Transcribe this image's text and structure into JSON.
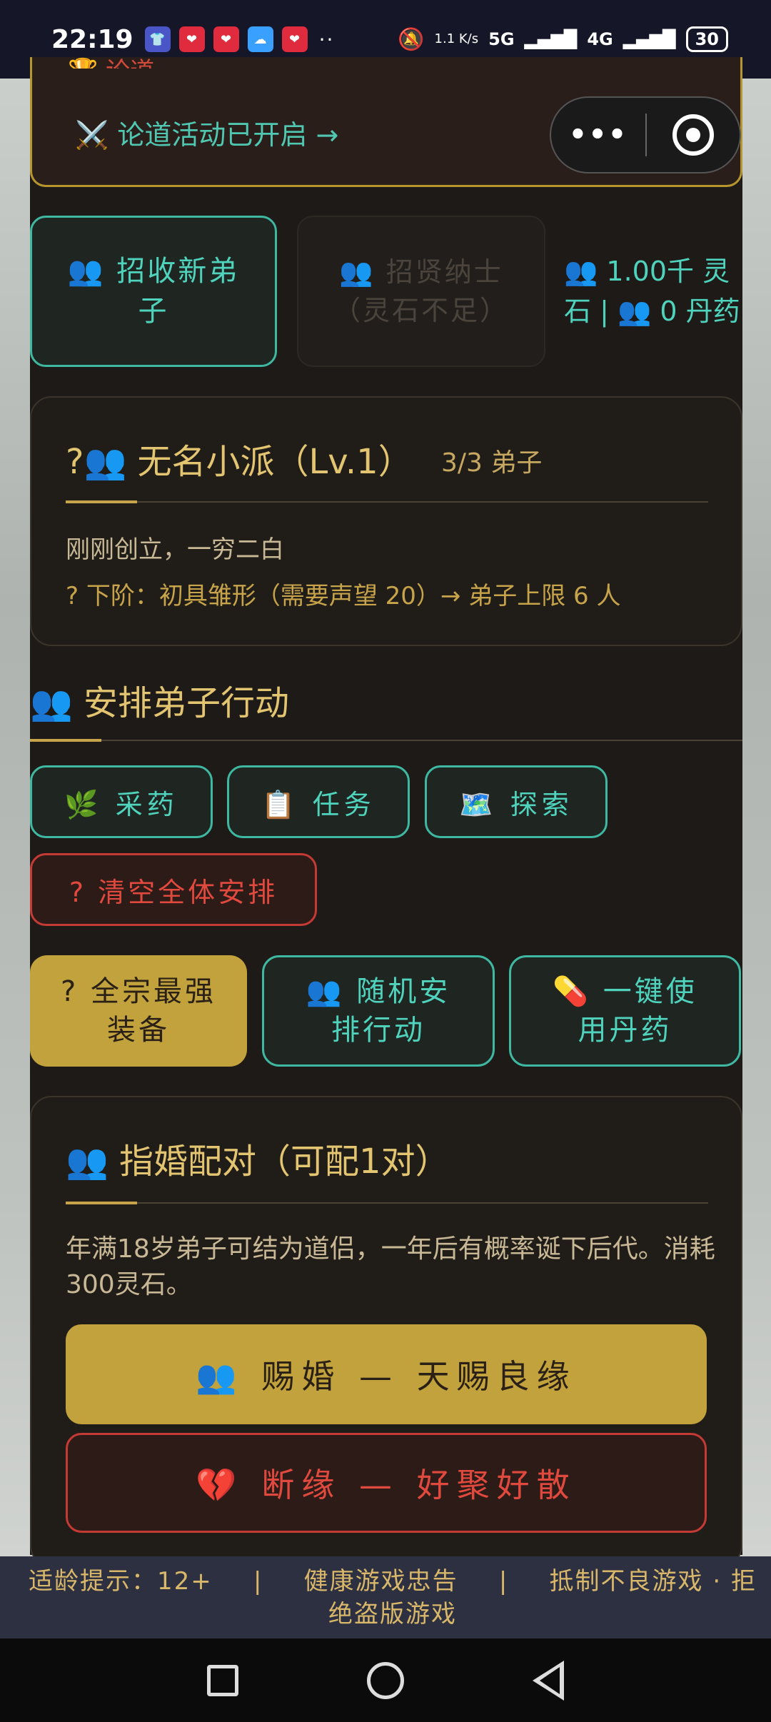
{
  "status_bar": {
    "time": "22:19",
    "net_speed": "1.1 K/s",
    "signal_1": "5G",
    "signal_2": "4G",
    "battery": "30"
  },
  "top_card": {
    "event_link": "⚔️ 论道活动已开启 →"
  },
  "actions_row": {
    "recruit_label": "👥 招收新弟子",
    "talent_label": "👥 招贤纳士（灵石不足）",
    "resources": "👥 1.00千 灵石 | 👥 0 丹药"
  },
  "sect": {
    "title": "?👥 无名小派（Lv.1）",
    "count": "3/3 弟子",
    "description": "刚刚创立，一穷二白",
    "next_tier": "? 下阶：初具雏形（需要声望 20）→ 弟子上限 6 人"
  },
  "arrange": {
    "title": "👥 安排弟子行动",
    "herb": "🌿 采药",
    "task": "📋 任务",
    "explore": "🗺️ 探索",
    "clear_all": "? 清空全体安排"
  },
  "bulk": {
    "best_gear": "? 全宗最强装备",
    "random_assign": "👥 随机安排行动",
    "use_pills": "💊 一键使用丹药"
  },
  "marriage": {
    "title": "👥 指婚配对（可配1对）",
    "description": "年满18岁弟子可结为道侣，一年后有概率诞下后代。消耗300灵石。",
    "grant_button": "👥 赐婚 — 天赐良缘",
    "break_button": "💔 断缘 — 好聚好散"
  },
  "footer": {
    "age_tip": "适龄提示：12+",
    "sep": "|",
    "health": "健康游戏忠告",
    "resist": "抵制不良游戏 · 拒",
    "line2": "绝盗版游戏"
  },
  "colors": {
    "gold": "#c2a23c",
    "teal": "#4fd3bd",
    "red": "#e04a3e",
    "panel": "#1d1a17"
  }
}
